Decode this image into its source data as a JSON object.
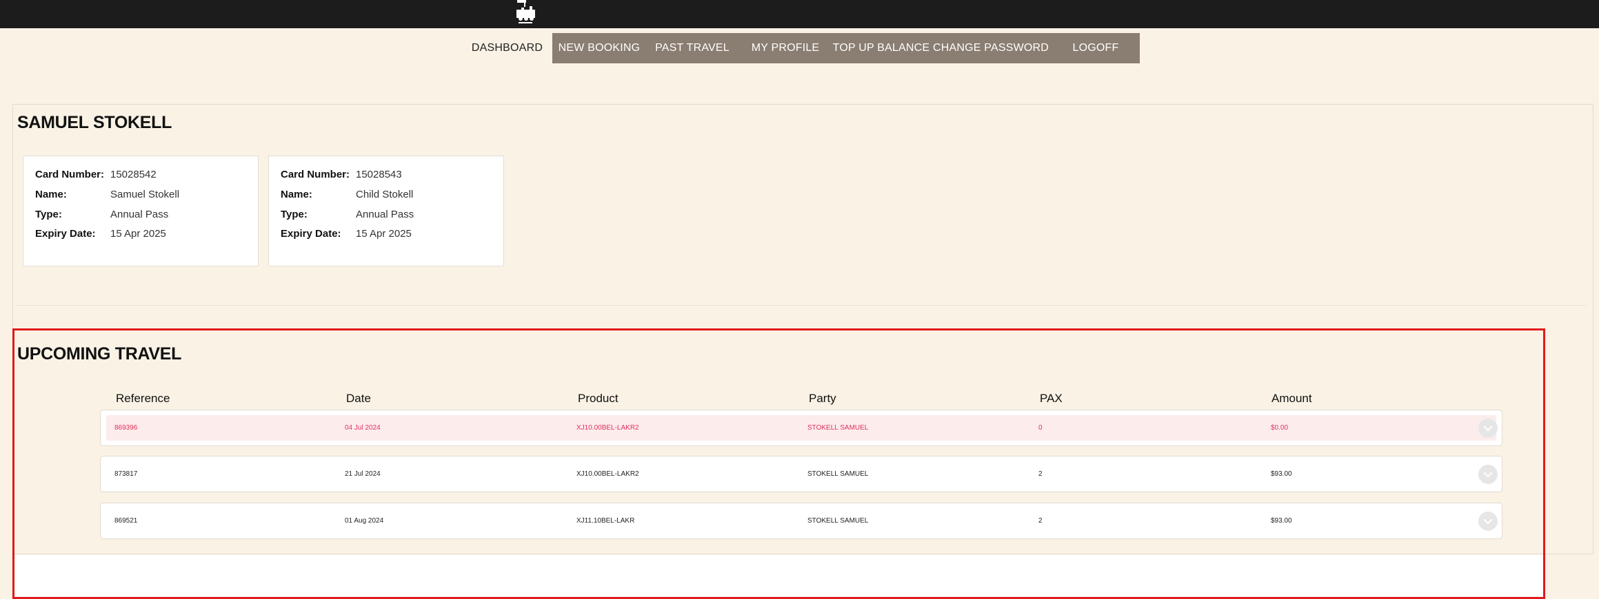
{
  "nav": {
    "items": [
      {
        "label": "DASHBOARD",
        "active": true
      },
      {
        "label": "NEW BOOKING",
        "active": false
      },
      {
        "label": "PAST TRAVEL",
        "active": false
      },
      {
        "label": "MY PROFILE",
        "active": false
      },
      {
        "label": "TOP UP BALANCE",
        "active": false
      },
      {
        "label": "CHANGE PASSWORD",
        "active": false
      },
      {
        "label": "LOGOFF",
        "active": false
      }
    ]
  },
  "profile": {
    "name_heading": "SAMUEL STOKELL",
    "cards": [
      {
        "card_number_key": "Card Number:",
        "card_number": "15028542",
        "name_key": "Name:",
        "name": "Samuel Stokell",
        "type_key": "Type:",
        "type": "Annual Pass",
        "expiry_key": "Expiry Date:",
        "expiry": "15 Apr 2025"
      },
      {
        "card_number_key": "Card Number:",
        "card_number": "15028543",
        "name_key": "Name:",
        "name": "Child Stokell",
        "type_key": "Type:",
        "type": "Annual Pass",
        "expiry_key": "Expiry Date:",
        "expiry": "15 Apr 2025"
      }
    ]
  },
  "upcoming": {
    "heading": "UPCOMING TRAVEL",
    "columns": [
      "Reference",
      "Date",
      "Product",
      "Party",
      "PAX",
      "Amount"
    ],
    "rows": [
      {
        "reference": "869396",
        "date": "04 Jul 2024",
        "product": "XJ10.00BEL-LAKR2",
        "party": "STOKELL SAMUEL",
        "pax": "0",
        "amount": "$0.00",
        "status": "cancelled"
      },
      {
        "reference": "873817",
        "date": "21 Jul 2024",
        "product": "XJ10.00BEL-LAKR2",
        "party": "STOKELL SAMUEL",
        "pax": "2",
        "amount": "$93.00",
        "status": "normal"
      },
      {
        "reference": "869521",
        "date": "01 Aug 2024",
        "product": "XJ11.10BEL-LAKR",
        "party": "STOKELL SAMUEL",
        "pax": "2",
        "amount": "$93.00",
        "status": "normal"
      }
    ]
  },
  "colors": {
    "page_background": "#f9f2e5",
    "nav_background": "#8a7d71",
    "top_bar": "#1c1c1c",
    "cancelled_text": "#e0305a",
    "cancelled_row": "#fdecec",
    "highlight_border": "#e0191b"
  },
  "icons": {
    "logo": "train-logo-icon",
    "expand": "chevron-down-icon"
  }
}
